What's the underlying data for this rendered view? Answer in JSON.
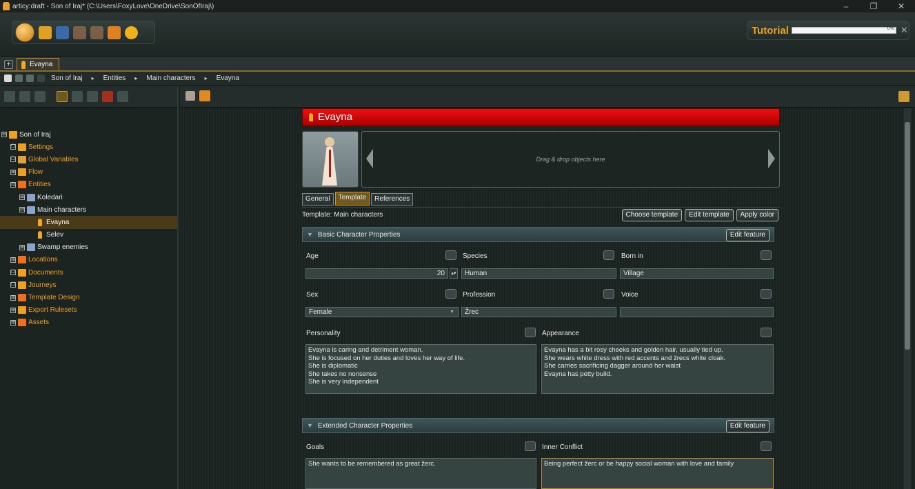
{
  "window": {
    "title": "articy:draft - Son of Iraj* (C:\\Users\\FoxyLove\\OneDrive\\SonOfIraj\\)",
    "minimize": "–",
    "maximize": "❐",
    "close": "✕"
  },
  "tutorial": {
    "label": "Tutorial",
    "progress": 0,
    "progress_text": "0%",
    "close": "✕"
  },
  "tabstrip": {
    "add": "+",
    "tab_label": "Evayna"
  },
  "breadcrumb": {
    "items": [
      "Son of Iraj",
      "Entities",
      "Main characters",
      "Evayna"
    ],
    "separator": "▸"
  },
  "tree": {
    "items": [
      {
        "label": "Son of Iraj",
        "level": 0,
        "expander": "⊟",
        "icon_color": "#f0a020"
      },
      {
        "label": "Settings",
        "level": 1,
        "expander": "☐",
        "icon_color": "#f0a020"
      },
      {
        "label": "Global Variables",
        "level": 1,
        "expander": "☐",
        "icon_color": "#e0a040"
      },
      {
        "label": "Flow",
        "level": 1,
        "expander": "⊞",
        "icon_color": "#f0a020"
      },
      {
        "label": "Entities",
        "level": 1,
        "expander": "⊟",
        "icon_color": "#f07020"
      },
      {
        "label": "Koledari",
        "level": 2,
        "expander": "⊞",
        "icon_color": "#8aa4c8"
      },
      {
        "label": "Main characters",
        "level": 2,
        "expander": "⊟",
        "icon_color": "#8aa4c8"
      },
      {
        "label": "Evayna",
        "level": 3,
        "expander": "",
        "icon_color": "#f2a820",
        "selected": true
      },
      {
        "label": "Selev",
        "level": 3,
        "expander": "",
        "icon_color": "#f2a820"
      },
      {
        "label": "Swamp enemies",
        "level": 2,
        "expander": "⊞",
        "icon_color": "#8aa4c8"
      },
      {
        "label": "Locations",
        "level": 1,
        "expander": "⊞",
        "icon_color": "#f07020"
      },
      {
        "label": "Documents",
        "level": 1,
        "expander": "☐",
        "icon_color": "#f0a020"
      },
      {
        "label": "Journeys",
        "level": 1,
        "expander": "☐",
        "icon_color": "#f0a020"
      },
      {
        "label": "Template Design",
        "level": 1,
        "expander": "⊞",
        "icon_color": "#f07020"
      },
      {
        "label": "Export Rulesets",
        "level": 1,
        "expander": "⊞",
        "icon_color": "#f0a020"
      },
      {
        "label": "Assets",
        "level": 1,
        "expander": "⊞",
        "icon_color": "#f07020"
      }
    ]
  },
  "entity": {
    "name": "Evayna",
    "dropzone_text": "Drag & drop objects here",
    "tabs": [
      "General",
      "Template",
      "References"
    ],
    "active_tab": "Template",
    "template_label": "Template: Main characters",
    "buttons": {
      "choose": "Choose template",
      "edit": "Edit template",
      "apply": "Apply color"
    },
    "basic": {
      "title": "Basic Character Properties",
      "edit_feature": "Edit feature",
      "age_label": "Age",
      "age_value": "20",
      "species_label": "Species",
      "species_value": "Human",
      "born_label": "Born in",
      "born_value": "Village",
      "sex_label": "Sex",
      "sex_value": "Female",
      "profession_label": "Profession",
      "profession_value": "Žrec",
      "voice_label": "Voice",
      "voice_value": "",
      "personality_label": "Personality",
      "personality_value": "Evayna is caring and detriment woman.\nShe is focused on her duties and loves her way of life.\nShe is diplomatic\nShe takes no nonsense\nShe is very independent",
      "appearance_label": "Appearance",
      "appearance_value": "Evayna has a bit rosy cheeks and golden hair, usually tied up.\nShe wears white dress with red accents and žrecs white cloak.\nShe carries sacrificing dagger around her waist\nEvayna has petty build."
    },
    "extended": {
      "title": "Extended Character Properties",
      "edit_feature": "Edit feature",
      "goals_label": "Goals",
      "goals_value": "She wants to be remembered as great žerc.",
      "conflict_label": "Inner Conflict",
      "conflict_value": "Being perfect žerc or be happy social woman with love and family"
    }
  }
}
